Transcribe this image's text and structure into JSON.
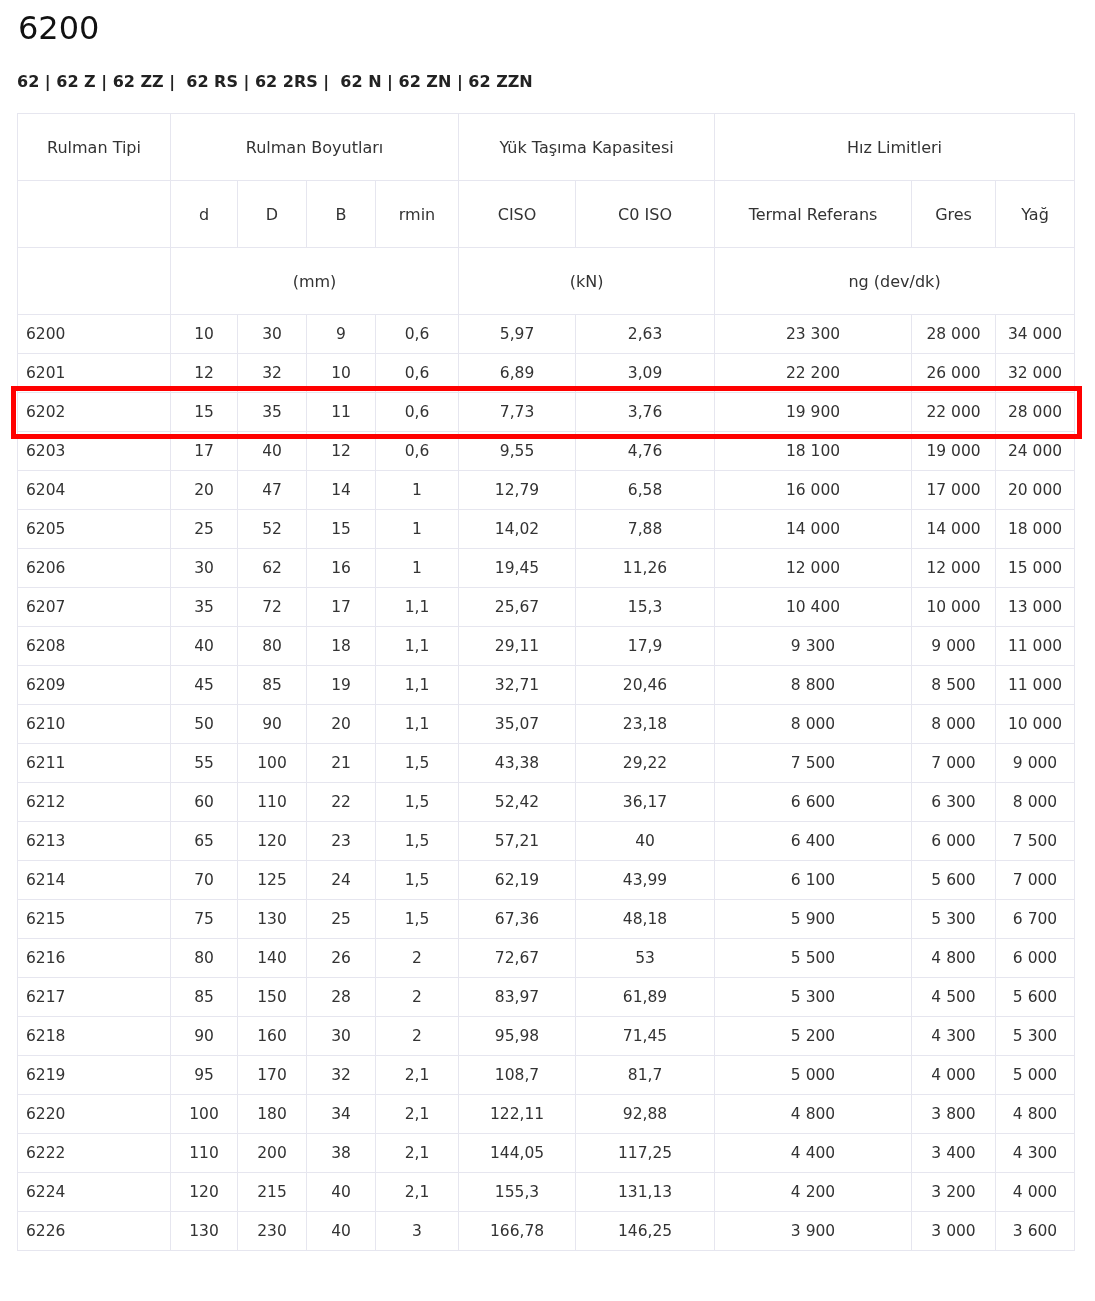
{
  "title": "6200",
  "series_links": "62 | 62 Z | 62 ZZ |  62 RS | 62 2RS |  62 N | 62 ZN | 62 ZZN",
  "table": {
    "group_headers": [
      "Rulman Tipi",
      "Rulman Boyutları",
      "Yük Taşıma Kapasitesi",
      "Hız Limitleri"
    ],
    "columns": [
      "",
      "d",
      "D",
      "B",
      "rmin",
      "CISO",
      "C0 ISO",
      "Termal Referans",
      "Gres",
      "Yağ"
    ],
    "units": [
      "(mm)",
      "(kN)",
      "ng (dev/dk)"
    ],
    "rows": [
      {
        "cells": [
          "6200",
          "10",
          "30",
          "9",
          "0,6",
          "5,97",
          "2,63",
          "23 300",
          "28 000",
          "34 000"
        ],
        "selected": false
      },
      {
        "cells": [
          "6201",
          "12",
          "32",
          "10",
          "0,6",
          "6,89",
          "3,09",
          "22 200",
          "26 000",
          "32 000"
        ],
        "selected": false
      },
      {
        "cells": [
          "6202",
          "15",
          "35",
          "11",
          "0,6",
          "7,73",
          "3,76",
          "19 900",
          "22 000",
          "28 000"
        ],
        "selected": true
      },
      {
        "cells": [
          "6203",
          "17",
          "40",
          "12",
          "0,6",
          "9,55",
          "4,76",
          "18 100",
          "19 000",
          "24 000"
        ],
        "selected": false
      },
      {
        "cells": [
          "6204",
          "20",
          "47",
          "14",
          "1",
          "12,79",
          "6,58",
          "16 000",
          "17 000",
          "20 000"
        ],
        "selected": false
      },
      {
        "cells": [
          "6205",
          "25",
          "52",
          "15",
          "1",
          "14,02",
          "7,88",
          "14 000",
          "14 000",
          "18 000"
        ],
        "selected": false
      },
      {
        "cells": [
          "6206",
          "30",
          "62",
          "16",
          "1",
          "19,45",
          "11,26",
          "12 000",
          "12 000",
          "15 000"
        ],
        "selected": false
      },
      {
        "cells": [
          "6207",
          "35",
          "72",
          "17",
          "1,1",
          "25,67",
          "15,3",
          "10 400",
          "10 000",
          "13 000"
        ],
        "selected": false
      },
      {
        "cells": [
          "6208",
          "40",
          "80",
          "18",
          "1,1",
          "29,11",
          "17,9",
          "9 300",
          "9 000",
          "11 000"
        ],
        "selected": false
      },
      {
        "cells": [
          "6209",
          "45",
          "85",
          "19",
          "1,1",
          "32,71",
          "20,46",
          "8 800",
          "8 500",
          "11 000"
        ],
        "selected": false
      },
      {
        "cells": [
          "6210",
          "50",
          "90",
          "20",
          "1,1",
          "35,07",
          "23,18",
          "8 000",
          "8 000",
          "10 000"
        ],
        "selected": false
      },
      {
        "cells": [
          "6211",
          "55",
          "100",
          "21",
          "1,5",
          "43,38",
          "29,22",
          "7 500",
          "7 000",
          "9 000"
        ],
        "selected": false
      },
      {
        "cells": [
          "6212",
          "60",
          "110",
          "22",
          "1,5",
          "52,42",
          "36,17",
          "6 600",
          "6 300",
          "8 000"
        ],
        "selected": false
      },
      {
        "cells": [
          "6213",
          "65",
          "120",
          "23",
          "1,5",
          "57,21",
          "40",
          "6 400",
          "6 000",
          "7 500"
        ],
        "selected": false
      },
      {
        "cells": [
          "6214",
          "70",
          "125",
          "24",
          "1,5",
          "62,19",
          "43,99",
          "6 100",
          "5 600",
          "7 000"
        ],
        "selected": false
      },
      {
        "cells": [
          "6215",
          "75",
          "130",
          "25",
          "1,5",
          "67,36",
          "48,18",
          "5 900",
          "5 300",
          "6 700"
        ],
        "selected": false
      },
      {
        "cells": [
          "6216",
          "80",
          "140",
          "26",
          "2",
          "72,67",
          "53",
          "5 500",
          "4 800",
          "6 000"
        ],
        "selected": false
      },
      {
        "cells": [
          "6217",
          "85",
          "150",
          "28",
          "2",
          "83,97",
          "61,89",
          "5 300",
          "4 500",
          "5 600"
        ],
        "selected": false
      },
      {
        "cells": [
          "6218",
          "90",
          "160",
          "30",
          "2",
          "95,98",
          "71,45",
          "5 200",
          "4 300",
          "5 300"
        ],
        "selected": false
      },
      {
        "cells": [
          "6219",
          "95",
          "170",
          "32",
          "2,1",
          "108,7",
          "81,7",
          "5 000",
          "4 000",
          "5 000"
        ],
        "selected": false
      },
      {
        "cells": [
          "6220",
          "100",
          "180",
          "34",
          "2,1",
          "122,11",
          "92,88",
          "4 800",
          "3 800",
          "4 800"
        ],
        "selected": false
      },
      {
        "cells": [
          "6222",
          "110",
          "200",
          "38",
          "2,1",
          "144,05",
          "117,25",
          "4 400",
          "3 400",
          "4 300"
        ],
        "selected": false
      },
      {
        "cells": [
          "6224",
          "120",
          "215",
          "40",
          "2,1",
          "155,3",
          "131,13",
          "4 200",
          "3 200",
          "4 000"
        ],
        "selected": false
      },
      {
        "cells": [
          "6226",
          "130",
          "230",
          "40",
          "3",
          "166,78",
          "146,25",
          "3 900",
          "3 000",
          "3 600"
        ],
        "selected": false
      }
    ]
  }
}
